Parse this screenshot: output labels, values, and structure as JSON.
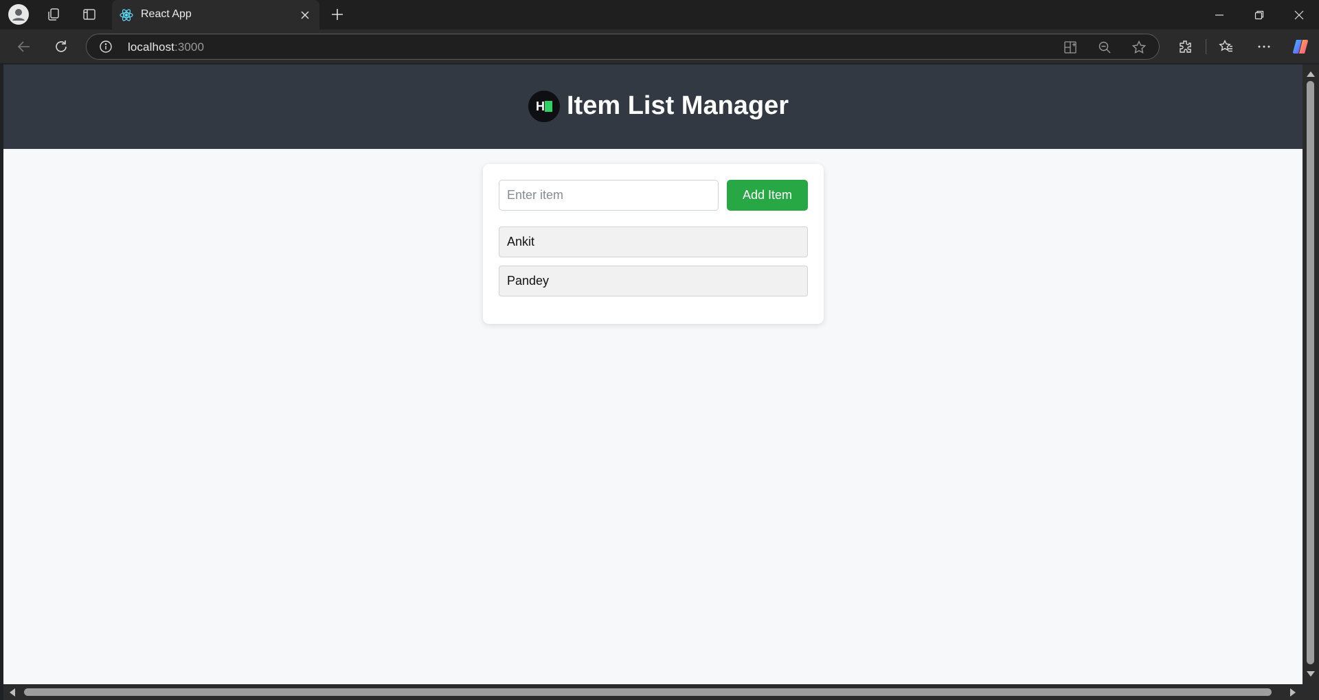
{
  "browser": {
    "tab_title": "React App",
    "url_host": "localhost",
    "url_port": ":3000"
  },
  "app": {
    "title": "Item List Manager",
    "logo_letter": "H",
    "input_placeholder": "Enter item",
    "input_value": "",
    "add_button_label": "Add Item",
    "items": [
      {
        "label": "Ankit"
      },
      {
        "label": "Pandey"
      }
    ]
  },
  "colors": {
    "header_bg": "#333942",
    "page_bg": "#f6f8fa",
    "add_button": "#28a745",
    "logo_accent": "#2fd266"
  },
  "icons": {
    "profile": "profile-icon",
    "workspaces": "workspaces-icon",
    "vertical_tabs": "vertical-tabs-icon",
    "tab_favicon": "react-icon",
    "tab_close": "close-icon",
    "new_tab": "plus-icon",
    "back": "back-arrow-icon",
    "reload": "reload-icon",
    "site_info": "info-icon",
    "apps": "apps-icon",
    "zoom": "zoom-out-icon",
    "favorite": "star-icon",
    "extensions": "extensions-icon",
    "favorites": "favorites-icon",
    "more": "more-icon",
    "copilot": "copilot-icon"
  }
}
